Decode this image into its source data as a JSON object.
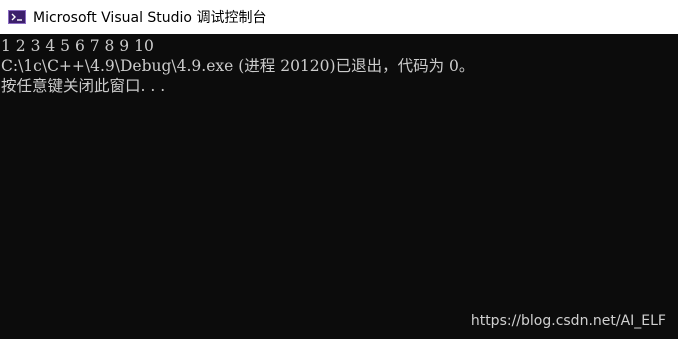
{
  "window": {
    "title": "Microsoft Visual Studio 调试控制台",
    "icon": "console-icon"
  },
  "console": {
    "lines": [
      "1 2 3 4 5 6 7 8 9 10",
      "C:\\1c\\C++\\4.9\\Debug\\4.9.exe (进程 20120)已退出，代码为 0。",
      "按任意键关闭此窗口. . ."
    ]
  },
  "watermark": "https://blog.csdn.net/AI_ELF",
  "colors": {
    "titlebar_background": "#ffffff",
    "console_background": "#0c0c0c",
    "console_text": "#cccccc",
    "icon_background": "#3c1f6b"
  }
}
